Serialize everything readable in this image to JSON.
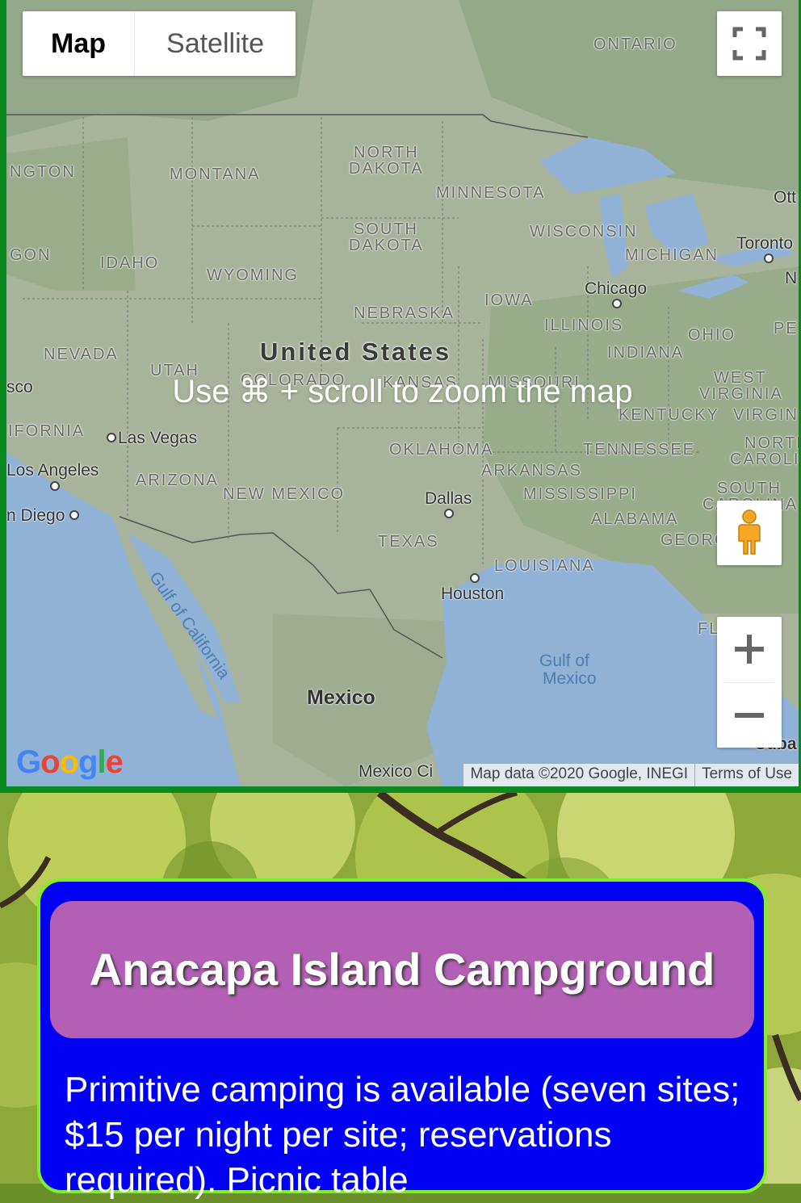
{
  "map": {
    "type_controls": {
      "map_label": "Map",
      "satellite_label": "Satellite"
    },
    "overlay_message": "Use ⌘ + scroll to zoom the map",
    "country_labels": {
      "us": "United States",
      "mexico": "Mexico"
    },
    "region_labels": {
      "ontario": "ONTARIO",
      "washington": "NGTON",
      "montana": "MONTANA",
      "north_dakota_1": "NORTH",
      "north_dakota_2": "DAKOTA",
      "minnesota": "MINNESOTA",
      "south_dakota_1": "SOUTH",
      "south_dakota_2": "DAKOTA",
      "oregon": "GON",
      "idaho": "IDAHO",
      "wyoming": "WYOMING",
      "wisconsin": "WISCONSIN",
      "michigan": "MICHIGAN",
      "iowa": "IOWA",
      "nebraska": "NEBRASKA",
      "illinois": "ILLINOIS",
      "ohio": "OHIO",
      "nevada": "NEVADA",
      "indiana": "INDIANA",
      "utah": "UTAH",
      "colorado": "COLORADO",
      "kansas": "KANSAS",
      "missouri": "MISSOURI",
      "west_virginia_1": "WEST",
      "west_virginia_2": "VIRGINIA",
      "california": "IFORNIA",
      "kentucky": "KENTUCKY",
      "virginia": "VIRGIN",
      "oklahoma": "OKLAHOMA",
      "tennessee": "TENNESSEE",
      "north_carolina_1": "NORTH",
      "north_carolina_2": "CAROLI",
      "arizona": "ARIZONA",
      "arkansas": "ARKANSAS",
      "new_mexico": "NEW MEXICO",
      "mississippi": "MISSISSIPPI",
      "south_carolina_1": "SOUTH",
      "south_carolina_2": "CAROLINA",
      "alabama": "ALABAMA",
      "texas": "TEXAS",
      "georgia": "GEORG",
      "louisiana": "LOUISIANA",
      "florida": "FL",
      "pennsylvania": "PE"
    },
    "city_labels": {
      "ottawa": "Ott",
      "toronto": "Toronto",
      "chicago": "Chicago",
      "san_francisco": "sco",
      "las_vegas": "Las Vegas",
      "los_angeles": "Los Angeles",
      "san_diego": "n Diego",
      "dallas": "Dallas",
      "houston": "Houston",
      "mexico_city": "Mexico Ci",
      "cuba": "Cuba",
      "new_york": "N"
    },
    "water_labels": {
      "gulf_of_california": "Gulf of California",
      "gulf_of_mexico_1": "Gulf of",
      "gulf_of_mexico_2": "Mexico"
    },
    "attribution": {
      "map_data": "Map data ©2020 Google, INEGI",
      "terms": "Terms of Use"
    },
    "logo_text": "Google",
    "colors": {
      "land": "#a9b49c",
      "water": "#8fb2d6",
      "frame": "#0a8a1e"
    }
  },
  "card": {
    "title": "Anacapa Island Campground",
    "description": "Primitive camping is available (seven sites; $15 per night per site; reservations required). Picnic table",
    "colors": {
      "background": "#0000f2",
      "border": "#7cf12b",
      "title_background": "#b35fb5"
    }
  }
}
